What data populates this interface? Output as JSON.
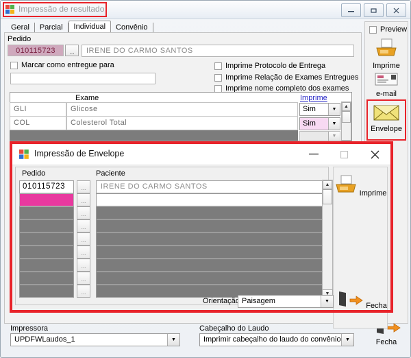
{
  "main_window": {
    "title": "Impressão de resultado",
    "app_icon": "windows-flag-icon",
    "window_buttons": {
      "minimize": "—",
      "maximize": "▫",
      "close": "✕"
    },
    "tabs": [
      {
        "label": "Geral",
        "active": false
      },
      {
        "label": "Parcial",
        "active": false
      },
      {
        "label": "Individual",
        "active": true
      },
      {
        "label": "Convênio",
        "active": false
      }
    ],
    "pedido": {
      "label": "Pedido",
      "value": "010115723",
      "browse_label": "...",
      "patient_name": "IRENE DO CARMO SANTOS"
    },
    "checkboxes_left": [
      {
        "label": "Marcar como entregue para",
        "checked": false
      }
    ],
    "entregue_input_value": "",
    "checkboxes_right": [
      {
        "label": "Imprime Protocolo de Entrega",
        "checked": false
      },
      {
        "label": "Imprime Relação de Exames Entregues",
        "checked": false
      },
      {
        "label": "Imprime nome completo dos exames",
        "checked": false
      }
    ],
    "exam_grid": {
      "header_exame": "Exame",
      "header_imprime": "Imprime",
      "rows": [
        {
          "code": "GLI",
          "name": "Glicose",
          "imprime": "Sim",
          "highlight": false
        },
        {
          "code": "COL",
          "name": "Colesterol Total",
          "imprime": "Sim",
          "highlight": true
        }
      ]
    },
    "toolbar": {
      "preview": {
        "label": "Preview",
        "checked": false
      },
      "buttons": [
        {
          "label": "Imprime",
          "icon": "printer-icon"
        },
        {
          "label": "e-mail",
          "icon": "email-icon"
        },
        {
          "label": "Envelope",
          "icon": "envelope-icon",
          "highlighted": true
        }
      ],
      "close_label": "Fecha",
      "close_icon": "exit-door-arrow-icon"
    },
    "bottom": {
      "impressora_label": "Impressora",
      "impressora_value": "UPDFWLaudos_1",
      "cabecalho_label": "Cabeçalho do Laudo",
      "cabecalho_value": "Imprimir cabeçalho do laudo do convênio"
    }
  },
  "envelope_dialog": {
    "title": "Impressão de Envelope",
    "app_icon": "windows-flag-icon",
    "window_buttons": {
      "minimize": "—",
      "maximize": "▫",
      "close": "✕"
    },
    "columns": {
      "pedido": "Pedido",
      "paciente": "Paciente"
    },
    "rows": [
      {
        "pedido": "010115723",
        "paciente": "IRENE DO CARMO SANTOS",
        "state": "active"
      },
      {
        "pedido": "",
        "paciente": "",
        "state": "selected"
      },
      {
        "pedido": "",
        "paciente": "",
        "state": "empty"
      },
      {
        "pedido": "",
        "paciente": "",
        "state": "empty"
      },
      {
        "pedido": "",
        "paciente": "",
        "state": "empty"
      },
      {
        "pedido": "",
        "paciente": "",
        "state": "empty"
      },
      {
        "pedido": "",
        "paciente": "",
        "state": "empty"
      },
      {
        "pedido": "",
        "paciente": "",
        "state": "empty"
      },
      {
        "pedido": "",
        "paciente": "",
        "state": "empty"
      }
    ],
    "browse_label": "...",
    "orientacao": {
      "label": "Orientação",
      "value": "Paisagem"
    },
    "toolbar": {
      "print": {
        "label": "Imprime",
        "icon": "printer-icon"
      },
      "close": {
        "label": "Fecha",
        "icon": "exit-door-arrow-icon"
      }
    },
    "highlight_color": "#e8232a"
  },
  "colors": {
    "highlight_red": "#e8232a",
    "selected_row_pink": "#e8399f",
    "pedido_field_mauve": "#cfa9bd",
    "combo_pink": "#f7d9f2",
    "link_blue": "#2626c6",
    "grid_gray": "#7c7c7c"
  }
}
